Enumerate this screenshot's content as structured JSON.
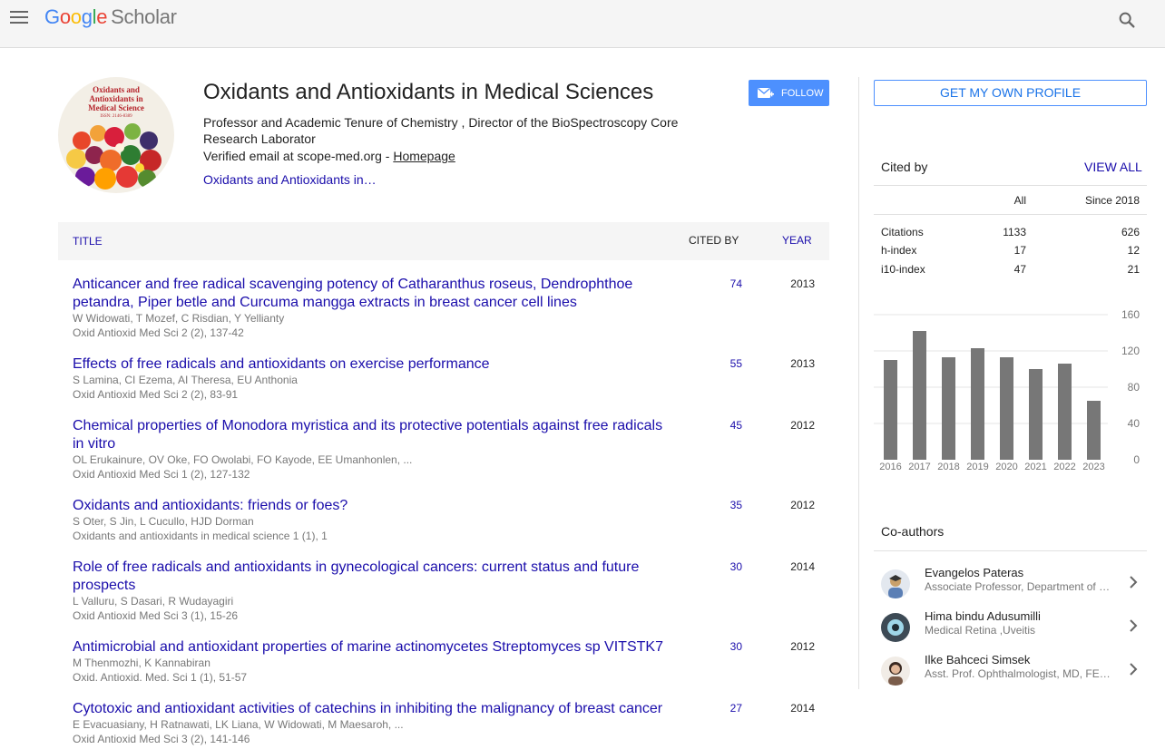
{
  "header": {
    "logo_letters": [
      "G",
      "o",
      "o",
      "g",
      "l",
      "e"
    ],
    "logo_product": "Scholar"
  },
  "avatar": {
    "title_lines": [
      "Oxidants and",
      "Antioxidants in",
      "Medical Science"
    ],
    "issn": "ISSN: 2146-8389"
  },
  "profile": {
    "name": "Oxidants and Antioxidants in Medical Sciences",
    "affiliation": "Professor and Academic Tenure of Chemistry , Director of the BioSpectroscopy Core Research Laborator",
    "email_text": "Verified email at scope-med.org - ",
    "homepage_label": "Homepage",
    "interest": "Oxidants and Antioxidants in…",
    "follow_label": "FOLLOW"
  },
  "table": {
    "col_title": "TITLE",
    "col_cited": "CITED BY",
    "col_year": "YEAR",
    "articles": [
      {
        "title": "Anticancer and free radical scavenging potency of Catharanthus roseus, Dendrophthoe petandra, Piper betle and Curcuma mangga extracts in breast cancer cell lines",
        "authors": "W Widowati, T Mozef, C Risdian, Y Yellianty",
        "venue": "Oxid Antioxid Med Sci 2 (2), 137-42",
        "cited": "74",
        "year": "2013"
      },
      {
        "title": "Effects of free radicals and antioxidants on exercise performance",
        "authors": "S Lamina, CI Ezema, AI Theresa, EU Anthonia",
        "venue": "Oxid Antioxid Med Sci 2 (2), 83-91",
        "cited": "55",
        "year": "2013"
      },
      {
        "title": "Chemical properties of Monodora myristica and its protective potentials against free radicals in vitro",
        "authors": "OL Erukainure, OV Oke, FO Owolabi, FO Kayode, EE Umanhonlen, ...",
        "venue": "Oxid Antioxid Med Sci 1 (2), 127-132",
        "cited": "45",
        "year": "2012"
      },
      {
        "title": "Oxidants and antioxidants: friends or foes?",
        "authors": "S Oter, S Jin, L Cucullo, HJD Dorman",
        "venue": "Oxidants and antioxidants in medical science 1 (1), 1",
        "cited": "35",
        "year": "2012"
      },
      {
        "title": "Role of free radicals and antioxidants in gynecological cancers: current status and future prospects",
        "authors": "L Valluru, S Dasari, R Wudayagiri",
        "venue": "Oxid Antioxid Med Sci 3 (1), 15-26",
        "cited": "30",
        "year": "2014"
      },
      {
        "title": "Antimicrobial and antioxidant properties of marine actinomycetes Streptomyces sp VITSTK7",
        "authors": "M Thenmozhi, K Kannabiran",
        "venue": "Oxid. Antioxid. Med. Sci 1 (1), 51-57",
        "cited": "30",
        "year": "2012"
      },
      {
        "title": "Cytotoxic and antioxidant activities of catechins in inhibiting the malignancy of breast cancer",
        "authors": "E Evacuasiany, H Ratnawati, LK Liana, W Widowati, M Maesaroh, ...",
        "venue": "Oxid Antioxid Med Sci 3 (2), 141-146",
        "cited": "27",
        "year": "2014"
      }
    ]
  },
  "sidebar": {
    "own_profile_label": "GET MY OWN PROFILE",
    "cited_by_label": "Cited by",
    "view_all_label": "VIEW ALL",
    "col_all": "All",
    "col_since": "Since 2018",
    "metrics": [
      {
        "label": "Citations",
        "all": "1133",
        "since": "626"
      },
      {
        "label": "h-index",
        "all": "17",
        "since": "12"
      },
      {
        "label": "i10-index",
        "all": "47",
        "since": "21"
      }
    ],
    "coauthors_label": "Co-authors",
    "coauthors": [
      {
        "name": "Evangelos Pateras",
        "desc": "Associate Professor, Department of Biomedical Sciences"
      },
      {
        "name": "Hima bindu Adusumilli",
        "desc": "Medical Retina ,Uveitis"
      },
      {
        "name": "Ilke Bahceci Simsek",
        "desc": "Asst. Prof. Ophthalmologist, MD, FEBO"
      }
    ]
  },
  "chart_data": {
    "type": "bar",
    "categories": [
      "2016",
      "2017",
      "2018",
      "2019",
      "2020",
      "2021",
      "2022",
      "2023"
    ],
    "values": [
      110,
      142,
      113,
      123,
      113,
      100,
      106,
      65
    ],
    "yticks": [
      "160",
      "120",
      "80",
      "40",
      "0"
    ],
    "ylim": [
      0,
      160
    ],
    "bar_color": "#777777"
  }
}
